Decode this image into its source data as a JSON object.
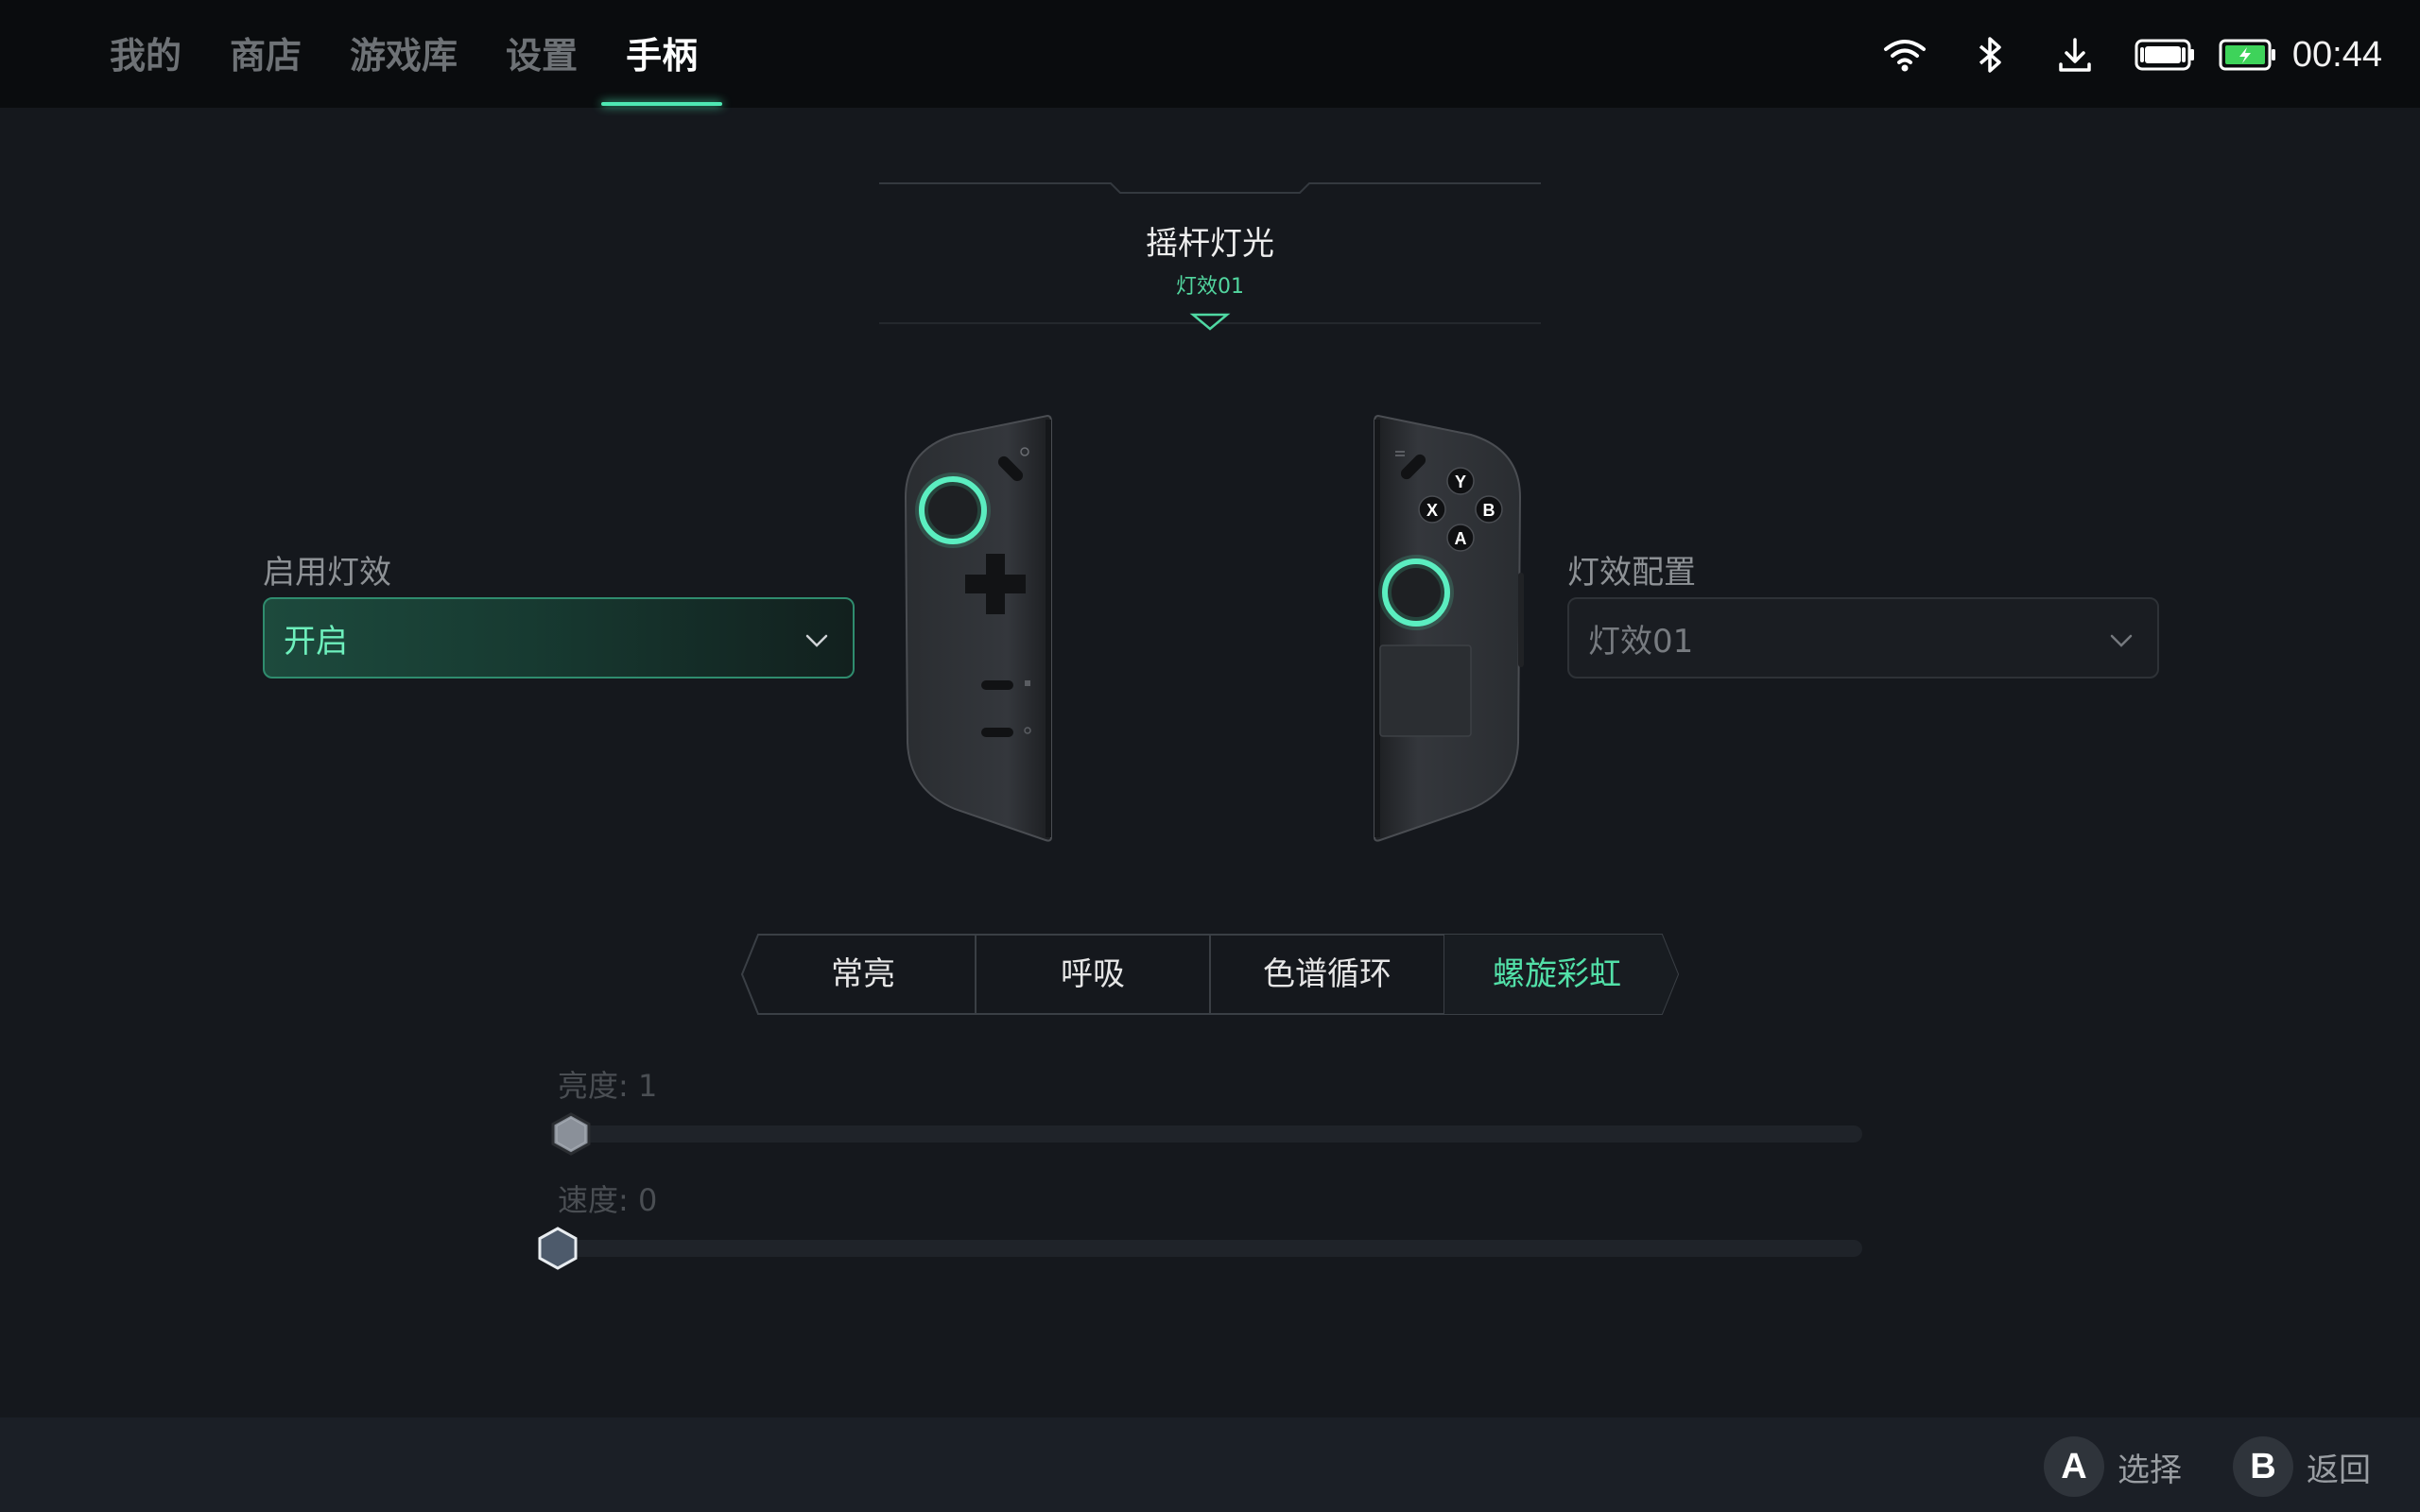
{
  "nav": {
    "tabs": [
      {
        "label": "我的"
      },
      {
        "label": "商店"
      },
      {
        "label": "游戏库"
      },
      {
        "label": "设置"
      },
      {
        "label": "手柄"
      }
    ],
    "active_tab": "手柄"
  },
  "status": {
    "icons": [
      "wifi-icon",
      "bluetooth-icon",
      "download-icon",
      "controller-battery-icon",
      "battery-charging-icon"
    ],
    "time": "00:44",
    "accent_color": "#4ee8b3"
  },
  "section": {
    "title": "摇杆灯光",
    "subtitle": "灯效01"
  },
  "enable_effect": {
    "label": "启用灯效",
    "value": "开启"
  },
  "effect_config": {
    "label": "灯效配置",
    "value": "灯效01"
  },
  "controller": {
    "buttons": {
      "y": "Y",
      "x": "X",
      "b": "B",
      "a": "A"
    }
  },
  "modes": {
    "options": [
      {
        "label": "常亮"
      },
      {
        "label": "呼吸"
      },
      {
        "label": "色谱循环"
      },
      {
        "label": "螺旋彩虹"
      }
    ],
    "selected": "螺旋彩虹"
  },
  "sliders": {
    "brightness": {
      "label": "亮度: 1",
      "value": 1
    },
    "speed": {
      "label": "速度: 0",
      "value": 0
    }
  },
  "footer": {
    "select": {
      "key": "A",
      "label": "选择"
    },
    "back": {
      "key": "B",
      "label": "返回"
    }
  }
}
